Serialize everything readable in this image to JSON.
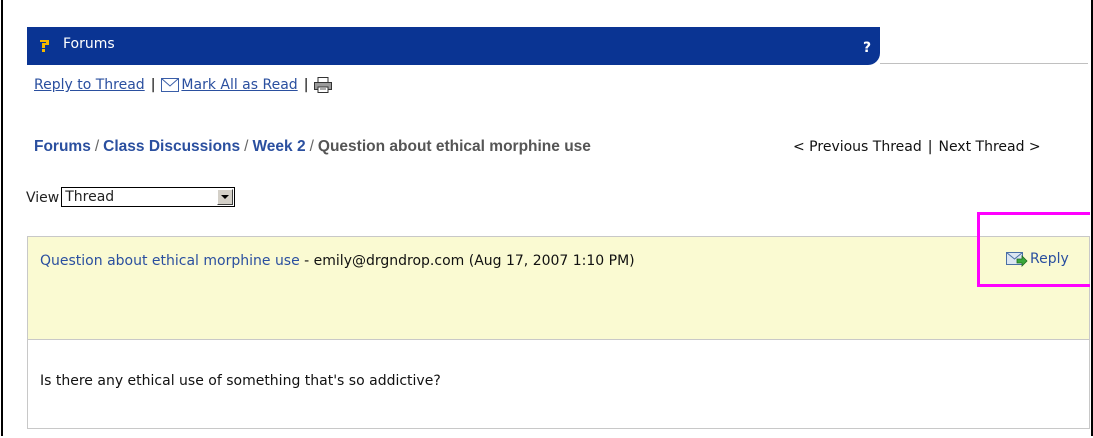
{
  "header": {
    "title": "Forums",
    "help_label": "?"
  },
  "toolbar": {
    "reply_to_thread": "Reply to Thread",
    "mark_all_read": "Mark All as Read",
    "separator": "|"
  },
  "breadcrumb": {
    "items": [
      "Forums",
      "Class Discussions",
      "Week 2"
    ],
    "separator": "/",
    "current": "Question about ethical morphine use"
  },
  "thread_nav": {
    "previous": "< Previous Thread",
    "separator": "|",
    "next": "Next Thread >"
  },
  "view": {
    "label": "View",
    "selected": "Thread"
  },
  "post": {
    "subject": "Question about ethical morphine use",
    "meta": " - emily@drgndrop.com (Aug 17, 2007 1:10 PM)",
    "reply_label": "Reply",
    "body": "Is there any ethical use of something that's so addictive?"
  },
  "colors": {
    "header_bg": "#0a3493",
    "link": "#2a4f9f",
    "post_header_bg": "#fafad2",
    "highlight": "#ff00ff"
  }
}
